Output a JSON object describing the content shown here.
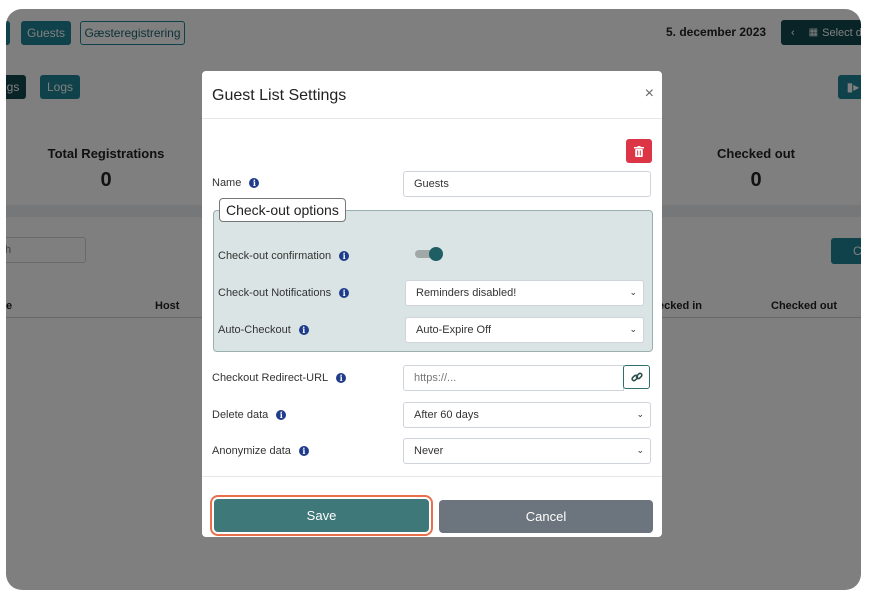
{
  "background": {
    "top_buttons": {
      "guests": "Guests",
      "registration": "Gæsteregistrering",
      "logs_left": "gs",
      "logs": "Logs"
    },
    "date": "5. december 2023",
    "select_btn": "Select d",
    "stats": {
      "total_label": "Total Registrations",
      "total_value": "0",
      "checked_out_label": "Checked out",
      "checked_out_value": "0"
    },
    "search_partial": "h",
    "right_btn_partial": "C",
    "table_headers": {
      "col1": "e",
      "host": "Host",
      "checked_in": "ecked in",
      "checked_out": "Checked out"
    }
  },
  "modal": {
    "title": "Guest List Settings",
    "close": "×",
    "name_label": "Name",
    "name_value": "Guests",
    "checkout_legend": "Check-out options",
    "checkout_confirmation_label": "Check-out confirmation",
    "checkout_confirmation_enabled": true,
    "checkout_notifications_label": "Check-out Notifications",
    "checkout_notifications_value": "Reminders disabled!",
    "auto_checkout_label": "Auto-Checkout",
    "auto_checkout_value": "Auto-Expire Off",
    "redirect_label": "Checkout Redirect-URL",
    "redirect_placeholder": "https://...",
    "delete_label": "Delete data",
    "delete_value": "After 60 days",
    "anonymize_label": "Anonymize data",
    "anonymize_value": "Never",
    "save_label": "Save",
    "cancel_label": "Cancel"
  },
  "colors": {
    "teal": "#1e8494",
    "dark_teal": "#12484f",
    "save": "#3e7878",
    "cancel": "#6c757d",
    "danger": "#dc3545",
    "info": "#1f3b8c",
    "focus_ring": "#e8704a"
  }
}
